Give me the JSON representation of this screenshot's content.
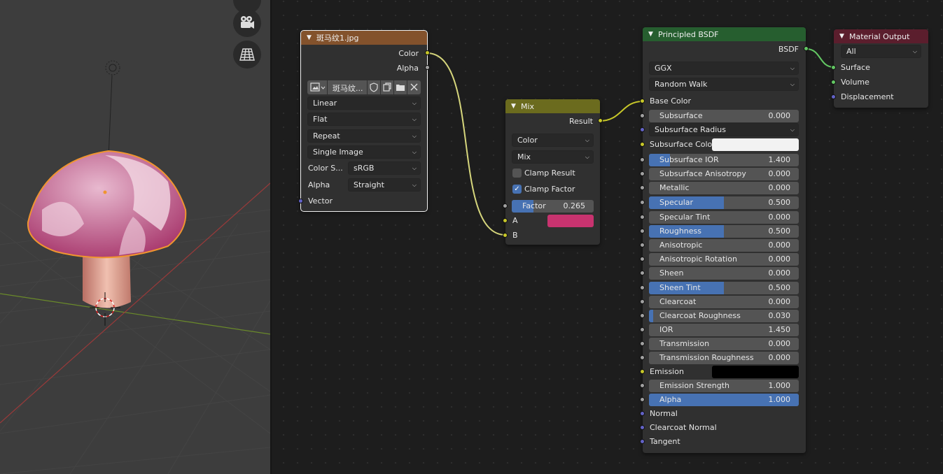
{
  "colors": {
    "image_header": "#83522c",
    "mix_header": "#6b6b1e",
    "bsdf_header": "#265e2f",
    "output_header": "#5b1e2d",
    "accent_blue": "#4772b3",
    "mix_b_color": "#c8336f",
    "subsurface_color": "#f2f2f2",
    "emission_color": "#000000"
  },
  "image_node": {
    "title": "斑马纹1.jpg",
    "out_color": "Color",
    "out_alpha": "Alpha",
    "image_name": "斑马纹...",
    "interpolation": "Linear",
    "projection": "Flat",
    "extension": "Repeat",
    "source": "Single Image",
    "color_space_label": "Color S...",
    "color_space": "sRGB",
    "alpha_label": "Alpha",
    "alpha_mode": "Straight",
    "in_vector": "Vector"
  },
  "mix_node": {
    "title": "Mix",
    "out_result": "Result",
    "data_type": "Color",
    "blend_type": "Mix",
    "clamp_result": "Clamp Result",
    "clamp_factor": "Clamp Factor",
    "factor_label": "Factor",
    "factor_value": "0.265",
    "factor": 0.265,
    "in_a": "A",
    "in_b": "B"
  },
  "bsdf_node": {
    "title": "Principled BSDF",
    "out_bsdf": "BSDF",
    "distribution": "GGX",
    "subsurface_method": "Random Walk",
    "base_color": "Base Color",
    "subsurface_radius": "Subsurface Radius",
    "subsurface_color": "Subsurface Color",
    "emission": "Emission",
    "normal": "Normal",
    "clearcoat_normal": "Clearcoat Normal",
    "tangent": "Tangent",
    "fields": [
      {
        "label": "Subsurface",
        "value": "0.000",
        "fraction": 0
      },
      {
        "label": "Subsurface IOR",
        "value": "1.400",
        "fraction": 0.14
      },
      {
        "label": "Subsurface Anisotropy",
        "value": "0.000",
        "fraction": 0
      },
      {
        "label": "Metallic",
        "value": "0.000",
        "fraction": 0
      },
      {
        "label": "Specular",
        "value": "0.500",
        "fraction": 0.5
      },
      {
        "label": "Specular Tint",
        "value": "0.000",
        "fraction": 0
      },
      {
        "label": "Roughness",
        "value": "0.500",
        "fraction": 0.5
      },
      {
        "label": "Anisotropic",
        "value": "0.000",
        "fraction": 0
      },
      {
        "label": "Anisotropic Rotation",
        "value": "0.000",
        "fraction": 0
      },
      {
        "label": "Sheen",
        "value": "0.000",
        "fraction": 0
      },
      {
        "label": "Sheen Tint",
        "value": "0.500",
        "fraction": 0.5
      },
      {
        "label": "Clearcoat",
        "value": "0.000",
        "fraction": 0
      },
      {
        "label": "Clearcoat Roughness",
        "value": "0.030",
        "fraction": 0.03
      },
      {
        "label": "IOR",
        "value": "1.450",
        "fraction": 0
      },
      {
        "label": "Transmission",
        "value": "0.000",
        "fraction": 0
      },
      {
        "label": "Transmission Roughness",
        "value": "0.000",
        "fraction": 0
      },
      {
        "label": "Emission Strength",
        "value": "1.000",
        "fraction": 0
      },
      {
        "label": "Alpha",
        "value": "1.000",
        "fraction": 1
      }
    ]
  },
  "output_node": {
    "title": "Material Output",
    "target": "All",
    "surface": "Surface",
    "volume": "Volume",
    "displacement": "Displacement"
  },
  "viewport_icons": [
    "camera-icon",
    "perspective-grid-icon"
  ]
}
